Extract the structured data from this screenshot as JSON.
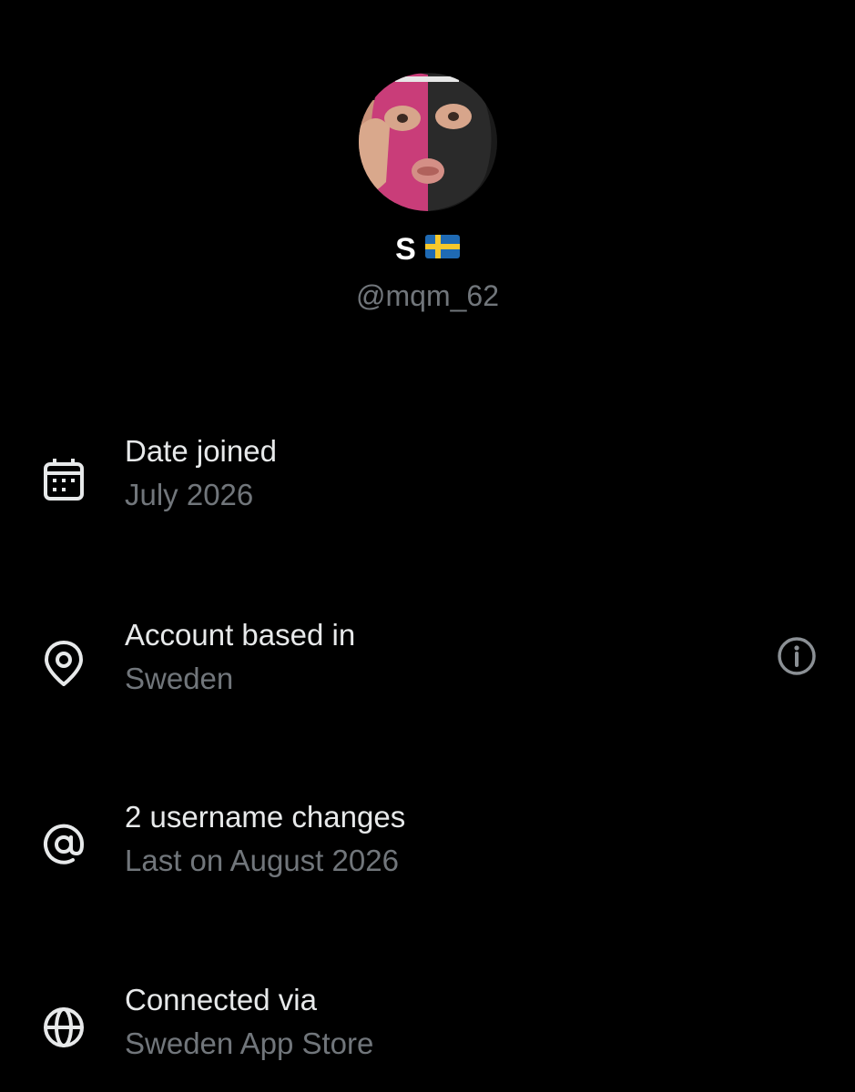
{
  "profile": {
    "display_name": "S",
    "flag_icon": "sweden-flag-icon",
    "handle": "@mqm_62",
    "avatar_colors": {
      "pink": "#c93d79",
      "black": "#262626",
      "skin": "#d9a88c"
    }
  },
  "rows": [
    {
      "icon": "calendar-icon",
      "title": "Date joined",
      "subtitle": "July 2026"
    },
    {
      "icon": "location-pin-icon",
      "title": "Account based in",
      "subtitle": "Sweden",
      "trailing_icon": "info-icon"
    },
    {
      "icon": "at-sign-icon",
      "title": "2 username changes",
      "subtitle": "Last on August 2026"
    },
    {
      "icon": "globe-icon",
      "title": "Connected via",
      "subtitle": "Sweden App Store"
    }
  ],
  "colors": {
    "background": "#000000",
    "primary_text": "#e7e9ea",
    "secondary_text": "#71767b"
  }
}
